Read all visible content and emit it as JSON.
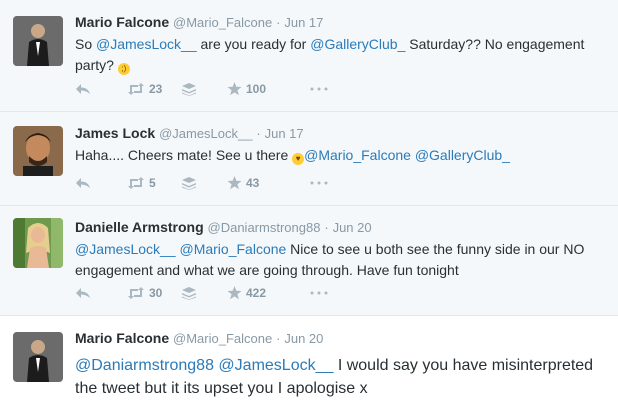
{
  "tweets": [
    {
      "fullname": "Mario Falcone",
      "username": "@Mario_Falcone",
      "dot": "·",
      "date": "Jun 17",
      "text_1": "So ",
      "mention_1": "@JamesLock__",
      "text_2": " are you ready for ",
      "mention_2": "@GalleryClub_",
      "text_3": " Saturday?? No engagement party? ",
      "retweets": "23",
      "favorites": "100",
      "avatar_color": "#3a3a3a"
    },
    {
      "fullname": "James Lock",
      "username": "@JamesLock__",
      "dot": "·",
      "date": "Jun 17",
      "text_1": "Haha.... Cheers mate! See u there ",
      "mention_1": "@Mario_Falcone",
      "mention_2": "@GalleryClub_",
      "retweets": "5",
      "favorites": "43",
      "avatar_color": "#6b4a2e"
    },
    {
      "fullname": "Danielle Armstrong",
      "username": "@Daniarmstrong88",
      "dot": "·",
      "date": "Jun 20",
      "mention_1": "@JamesLock__",
      "mention_2": "@Mario_Falcone",
      "text_1": " Nice to see u both see the funny side in our NO engagement and what we are going through. Have fun tonight",
      "retweets": "30",
      "favorites": "422",
      "avatar_color": "#7aa35a"
    },
    {
      "fullname": "Mario Falcone",
      "username": "@Mario_Falcone",
      "dot": "·",
      "date": "Jun 20",
      "mention_1": "@Daniarmstrong88",
      "mention_2": "@JamesLock__",
      "text_1": " I would say you have misinterpreted the tweet but it its upset you I apologise x",
      "avatar_color": "#3a3a3a"
    }
  ],
  "colors": {
    "link": "#2b7bb9",
    "muted": "#8899a6",
    "icon": "#aab8c2",
    "background": "#f5f8fa"
  },
  "icons": [
    "reply-icon",
    "retweet-icon",
    "layers-icon",
    "favorite-star-icon",
    "more-icon"
  ]
}
